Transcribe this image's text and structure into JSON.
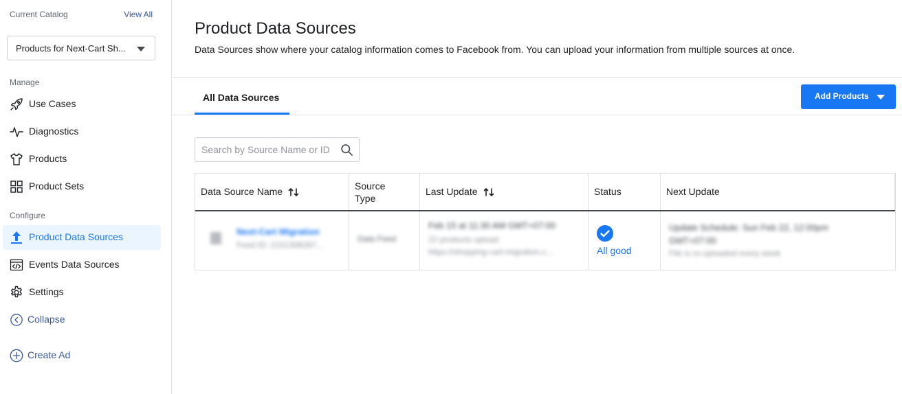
{
  "sidebar": {
    "catalog_label": "Current Catalog",
    "view_all": "View All",
    "catalog_selected": "Products for Next-Cart Sh...",
    "manage_label": "Manage",
    "configure_label": "Configure",
    "manage_items": [
      {
        "label": "Use Cases",
        "icon": "rocket-icon"
      },
      {
        "label": "Diagnostics",
        "icon": "pulse-icon"
      },
      {
        "label": "Products",
        "icon": "shirt-icon"
      },
      {
        "label": "Product Sets",
        "icon": "grid-icon"
      }
    ],
    "configure_items": [
      {
        "label": "Product Data Sources",
        "icon": "upload-icon",
        "active": true
      },
      {
        "label": "Events Data Sources",
        "icon": "code-window-icon"
      },
      {
        "label": "Settings",
        "icon": "gear-icon"
      }
    ],
    "collapse": "Collapse",
    "create_ad": "Create Ad"
  },
  "header": {
    "title": "Product Data Sources",
    "description": "Data Sources show where your catalog information comes to Facebook from. You can upload your information from multiple sources at once."
  },
  "tabs": [
    {
      "label": "All Data Sources",
      "active": true
    }
  ],
  "add_products": "Add Products",
  "search": {
    "placeholder": "Search by Source Name or ID"
  },
  "table": {
    "columns": [
      "Data Source Name",
      "Source Type",
      "Last Update",
      "Status",
      "Next Update"
    ],
    "rows": [
      {
        "name": "Next-Cart Migration",
        "feed_id": "Feed ID: 2151308287...",
        "source_type": "Data Feed",
        "last_update": [
          "Feb 15 at 11:30 AM GMT+07:00",
          "22 products upload",
          "https://shopping-cart-migration.c..."
        ],
        "status": "All good",
        "next_update": [
          "Update Schedule: Sun Feb 22, 12:00pm",
          "GMT+07:00",
          "File is re-uploaded every week"
        ]
      }
    ]
  },
  "colors": {
    "accent": "#1877f2",
    "link": "#385898",
    "active_bg": "#ebf5ff"
  }
}
